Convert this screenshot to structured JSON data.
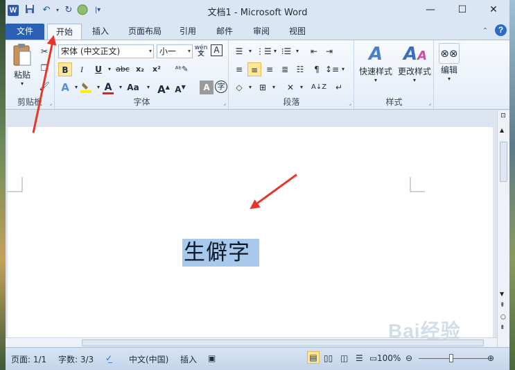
{
  "window": {
    "title": "文档1 - Microsoft Word",
    "controls": [
      "—",
      "☐",
      "✕"
    ]
  },
  "quick_access": {
    "app_icon": "W",
    "save_icon": "save-icon",
    "undo_icon": "undo-icon",
    "redo_icon": "redo-icon",
    "customize_icon": "customize-icon"
  },
  "tabs": [
    {
      "label": "文件",
      "active": false
    },
    {
      "label": "开始",
      "active": true
    },
    {
      "label": "插入",
      "active": false
    },
    {
      "label": "页面布局",
      "active": false
    },
    {
      "label": "引用",
      "active": false
    },
    {
      "label": "邮件",
      "active": false
    },
    {
      "label": "审阅",
      "active": false
    },
    {
      "label": "视图",
      "active": false
    }
  ],
  "ribbon": {
    "clipboard": {
      "label": "剪贴板",
      "paste_label": "粘贴"
    },
    "font": {
      "label": "字体",
      "font_name": "宋体 (中文正文)",
      "font_size": "小一",
      "bold": "B",
      "italic": "I",
      "underline": "U",
      "strike": "abc",
      "subscript": "x₂",
      "superscript": "x²",
      "grow": "A",
      "shrink": "A",
      "case": "Aa",
      "pinyin": "wén",
      "char_border": "A",
      "char_shading": "A",
      "enclose": "字"
    },
    "paragraph": {
      "label": "段落"
    },
    "styles": {
      "label": "样式",
      "quick_styles": "快速样式",
      "change_styles": "更改样式"
    },
    "editing": {
      "label": "编辑"
    }
  },
  "document": {
    "text": "生僻字"
  },
  "status": {
    "page": "页面: 1/1",
    "words": "字数: 3/3",
    "language": "中文(中国)",
    "mode": "插入",
    "zoom": "100%"
  },
  "watermark": "Bai经验"
}
